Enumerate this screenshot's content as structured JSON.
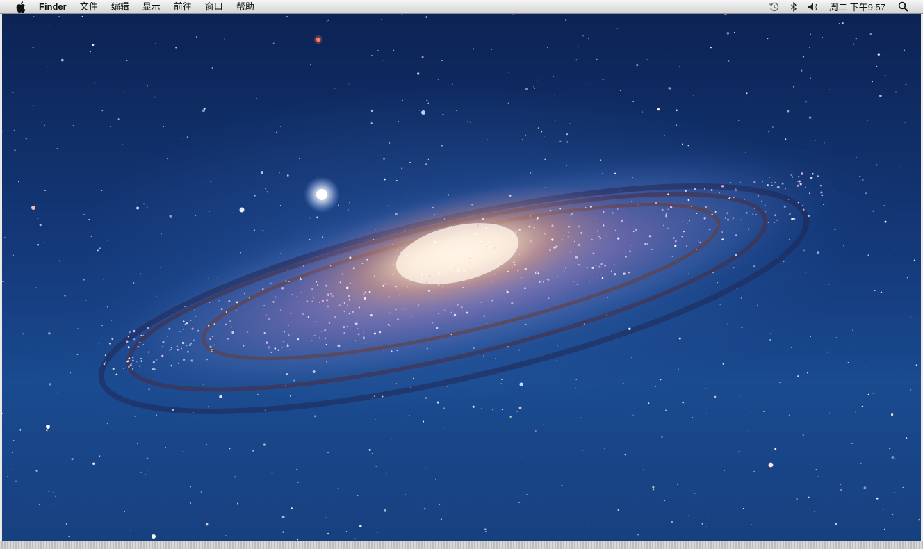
{
  "menubar": {
    "apple_icon": "apple-logo-icon",
    "app_name": "Finder",
    "menus": [
      "文件",
      "编辑",
      "显示",
      "前往",
      "窗口",
      "帮助"
    ],
    "status_icons": [
      "time-machine-icon",
      "bluetooth-icon",
      "volume-icon"
    ],
    "clock": "周二 下午9:57",
    "search_icon": "spotlight-search-icon"
  },
  "desktop": {
    "wallpaper": "andromeda-galaxy",
    "colors": {
      "sky_top": "#0c2354",
      "sky_bottom": "#1a4a8f",
      "galaxy_core": "#fbe6cc",
      "galaxy_arm": "#7a6fb0"
    }
  }
}
